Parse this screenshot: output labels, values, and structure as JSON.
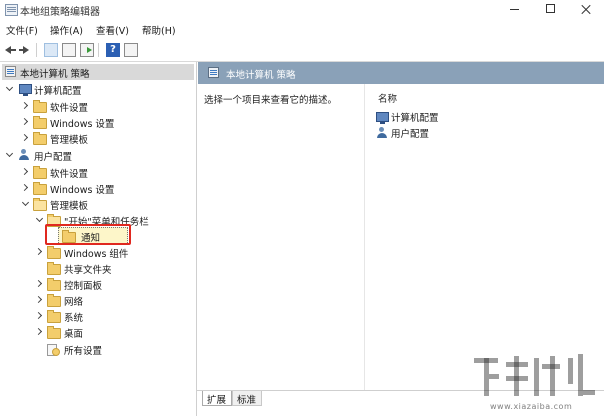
{
  "window": {
    "title": "本地组策略编辑器"
  },
  "menu": {
    "items": [
      "文件(F)",
      "操作(A)",
      "查看(V)",
      "帮助(H)"
    ]
  },
  "toolbar": {
    "help_label": "?"
  },
  "tree": {
    "root": "本地计算机 策略",
    "computer_config": "计算机配置",
    "cc_software": "软件设置",
    "cc_windows": "Windows 设置",
    "cc_admin": "管理模板",
    "user_config": "用户配置",
    "uc_software": "软件设置",
    "uc_windows": "Windows 设置",
    "uc_admin": "管理模板",
    "start_menu": "\"开始\"菜单和任务栏",
    "notify": "通知",
    "windows_components": "Windows 组件",
    "shared_folders": "共享文件夹",
    "control_panel": "控制面板",
    "network": "网络",
    "system": "系统",
    "desktop": "桌面",
    "all_settings": "所有设置"
  },
  "details": {
    "header": "本地计算机 策略",
    "description": "选择一个项目来查看它的描述。",
    "name_column": "名称",
    "items": [
      "计算机配置",
      "用户配置"
    ]
  },
  "tabs": {
    "expanded": "扩展",
    "standard": "标准"
  },
  "watermark": {
    "url": "www.xiazaiba.com"
  }
}
